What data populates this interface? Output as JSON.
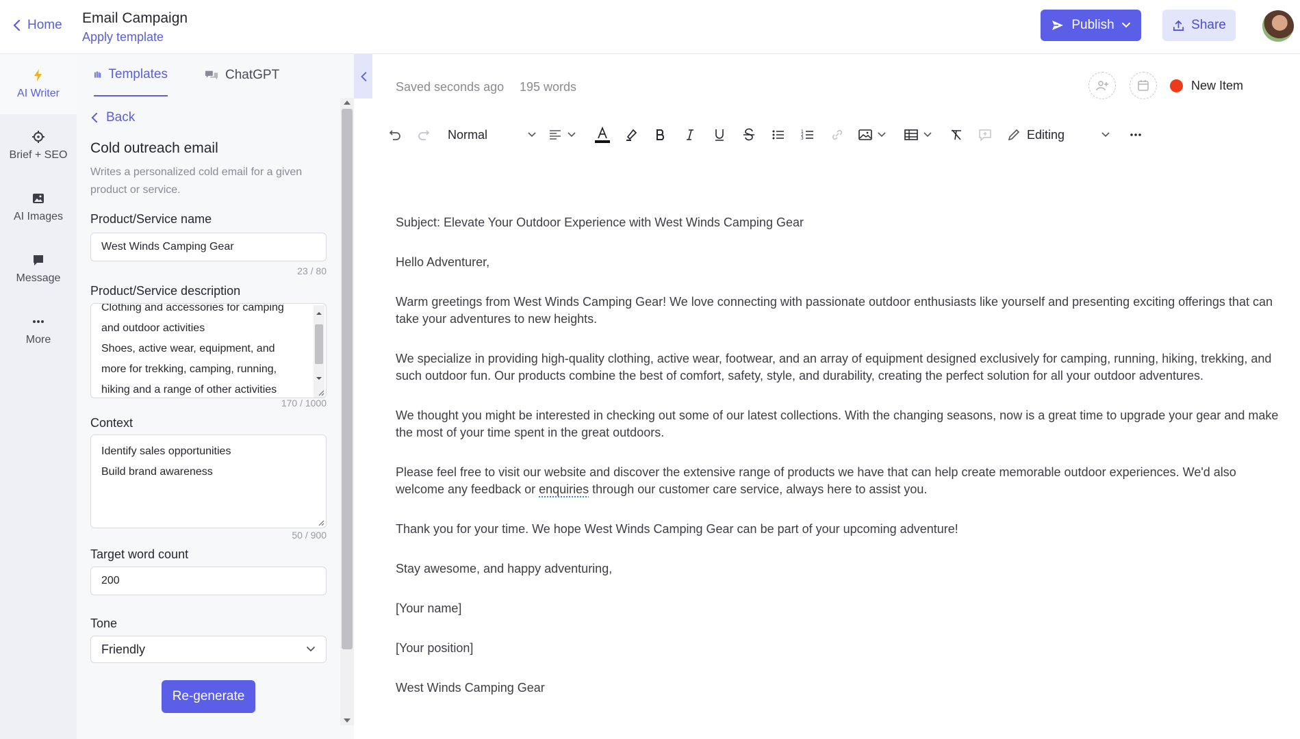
{
  "header": {
    "home_label": "Home",
    "doc_title": "Email Campaign",
    "apply_template": "Apply template",
    "publish_label": "Publish",
    "share_label": "Share"
  },
  "rail": {
    "items": [
      {
        "label": "AI Writer",
        "icon": "lightning-icon"
      },
      {
        "label": "Brief + SEO",
        "icon": "crosshair-icon"
      },
      {
        "label": "AI Images",
        "icon": "image-icon"
      },
      {
        "label": "Message",
        "icon": "chat-bubble-icon"
      },
      {
        "label": "More",
        "icon": "ellipsis-icon"
      }
    ]
  },
  "panel": {
    "tabs": [
      {
        "label": "Templates",
        "icon": "library-icon"
      },
      {
        "label": "ChatGPT",
        "icon": "chat-icon"
      }
    ],
    "back_label": "Back",
    "form_title": "Cold outreach email",
    "form_description": "Writes a personalized cold email for a given product or service.",
    "fields": {
      "product_name": {
        "label": "Product/Service name",
        "value": "West Winds Camping Gear",
        "counter": "23 / 80"
      },
      "product_description": {
        "label": "Product/Service description",
        "lines": [
          "Clothing and accessories for camping",
          "and outdoor activities",
          "Shoes, active wear, equipment, and",
          "more for trekking, camping, running,",
          "hiking and a range of other activities"
        ],
        "counter": "170 / 1000"
      },
      "context": {
        "label": "Context",
        "lines": [
          "Identify sales opportunities",
          "Build brand awareness"
        ],
        "counter": "50 / 900"
      },
      "word_count": {
        "label": "Target word count",
        "value": "200"
      },
      "tone": {
        "label": "Tone",
        "value": "Friendly"
      }
    },
    "regenerate_label": "Re-generate"
  },
  "editor": {
    "saved_status": "Saved seconds ago",
    "word_count": "195 words",
    "new_item_label": "New Item",
    "new_item_color": "#ef3a1a",
    "toolbar": {
      "style_value": "Normal",
      "mode_value": "Editing"
    },
    "paragraphs": {
      "subject": "Subject: Elevate Your Outdoor Experience with West Winds Camping Gear",
      "greeting": "Hello Adventurer,",
      "p1": "Warm greetings from West Winds Camping Gear! We love connecting with passionate outdoor enthusiasts like yourself and presenting exciting offerings that can take your adventures to new heights.",
      "p2": "We specialize in providing high-quality clothing, active wear, footwear, and an array of equipment designed exclusively for camping, running, hiking, trekking, and such outdoor fun. Our products combine the best of comfort, safety, style, and durability, creating the perfect solution for all your outdoor adventures.",
      "p3": "We thought you might be interested in checking out some of our latest collections. With the changing seasons, now is a great time to upgrade your gear and make the most of your time spent in the great outdoors.",
      "p4_before": "Please feel free to visit our website and discover the extensive range of products we have that can help create memorable outdoor experiences. We'd also welcome any feedback or ",
      "p4_flagged": "enquiries",
      "p4_after": " through our customer care service, always here to assist you.",
      "p5": "Thank you for your time. We hope West Winds Camping Gear can be part of your upcoming adventure!",
      "signoff": "Stay awesome, and happy adventuring,",
      "name": "[Your name]",
      "position": "[Your position]",
      "company": "West Winds Camping Gear"
    }
  },
  "colors": {
    "accent": "#5b5ee6",
    "accent_text": "#5b5fd6",
    "rail_bg": "#eef0f5",
    "panel_bg": "#f7f8fa"
  }
}
